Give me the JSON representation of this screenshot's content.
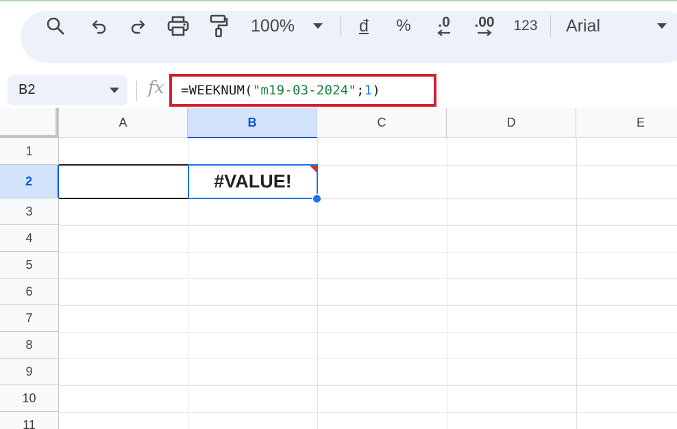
{
  "toolbar": {
    "search_icon": "search-icon",
    "undo_icon": "undo-icon",
    "redo_icon": "redo-icon",
    "print_icon": "print-icon",
    "paint_format_icon": "paint-format-icon",
    "zoom": "100%",
    "currency": "đ",
    "percent": "%",
    "decrease_decimal": ".0",
    "increase_decimal": ".00",
    "number_format": "123",
    "font": "Arial"
  },
  "formula_bar": {
    "cell_ref": "B2",
    "fx_label": "fx",
    "formula_prefix": "=WEEKNUM(",
    "formula_string": "\"m19-03-2024\"",
    "formula_separator": ";",
    "formula_arg": "1",
    "formula_suffix": ")"
  },
  "columns": [
    "A",
    "B",
    "C",
    "D",
    "E"
  ],
  "rows": [
    "1",
    "2",
    "3",
    "4",
    "5",
    "6",
    "7",
    "8",
    "9",
    "10",
    "11"
  ],
  "selection": {
    "column": "B",
    "row": "2"
  },
  "cells": {
    "B2": "#VALUE!"
  },
  "colors": {
    "accent": "#1a73e8",
    "error": "#d93025",
    "highlight_box": "#d4202e"
  }
}
